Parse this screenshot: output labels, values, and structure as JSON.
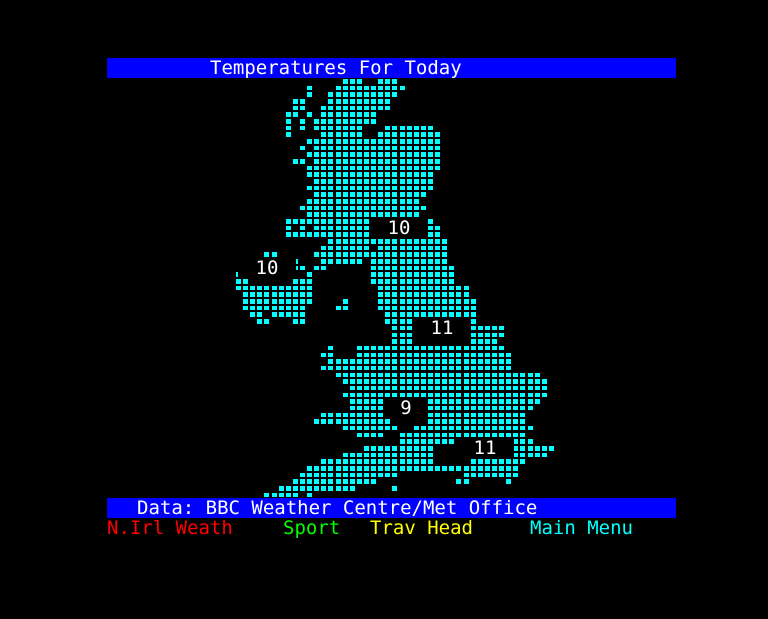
{
  "header": {
    "title": "Temperatures For Today",
    "background_color": "#0000ff",
    "text_color": "#ffffff"
  },
  "map": {
    "land_color": "#00ffff",
    "region": "United Kingdom and Ireland",
    "temperatures": [
      {
        "region": "Scotland",
        "value": "10"
      },
      {
        "region": "Northern Ireland",
        "value": "10"
      },
      {
        "region": "Northern England",
        "value": "11"
      },
      {
        "region": "Wales / West",
        "value": "9"
      },
      {
        "region": "South East",
        "value": "11"
      }
    ]
  },
  "footer": {
    "source": "Data: BBC Weather Centre/Met Office",
    "fastext": [
      {
        "label": "N.Irl Weath",
        "color": "#ff0000"
      },
      {
        "label": "Sport",
        "color": "#00ff00"
      },
      {
        "label": "Trav Head",
        "color": "#ffff00"
      },
      {
        "label": "Main Menu",
        "color": "#00ffff"
      }
    ]
  }
}
